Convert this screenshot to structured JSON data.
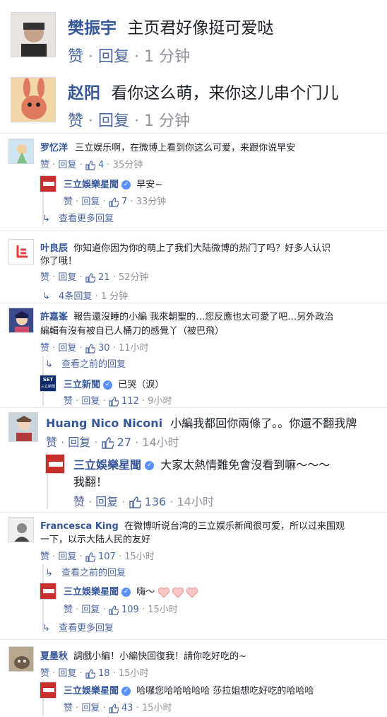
{
  "comments": [
    {
      "name": "樊振宇",
      "text": "主页君好像挺可爱哒",
      "like": "赞",
      "reply": "回复",
      "time": "1 分钟"
    },
    {
      "name": "赵阳",
      "text": "看你这么萌，来你这儿串个门儿",
      "like": "赞",
      "reply": "回复",
      "time": "1 分钟"
    },
    {
      "name": "罗忆洋",
      "text": "三立娱乐啊，在微博上看到你这么可爱，来跟你说早安",
      "like": "赞",
      "reply": "回复",
      "likes": "4",
      "time": "35分钟",
      "replies": [
        {
          "name": "三立娛樂星聞",
          "text": "早安~",
          "like": "赞",
          "reply": "回复",
          "likes": "7",
          "time": "33分钟"
        }
      ],
      "more": "查看更多回复"
    },
    {
      "name": "叶良辰",
      "text1": "你知道你因为你的萌上了我们大陆微博的热门了吗？好多人认识",
      "text2": "你了哦！",
      "like": "赞",
      "reply": "回复",
      "likes": "21",
      "time": "52分钟",
      "more": "4条回复",
      "more_time": "1 分钟"
    },
    {
      "name": "許嘉峯",
      "text1": "報告還沒睡的小編 我來朝聖的…您反應也太可愛了吧…另外政治",
      "text2": "編輯有沒有被自已人桶刀的感覺丫（被巴飛）",
      "like": "赞",
      "reply": "回复",
      "likes": "30",
      "time": "11小时",
      "prev": "查看之前的回复",
      "replies": [
        {
          "name": "三立新聞",
          "text": "已哭（淚）",
          "like": "赞",
          "reply": "回复",
          "likes": "112",
          "time": "9小时"
        }
      ]
    },
    {
      "name": "Huang Nico Niconi",
      "text": "小編我都回你兩條了。。你還不翻我牌",
      "like": "赞",
      "reply": "回复",
      "likes": "27",
      "time": "14小时",
      "replies": [
        {
          "name": "三立娛樂星聞",
          "text1": "大家太熱情難免會沒看到嘛～～～",
          "text2": "我翻！",
          "like": "赞",
          "reply": "回复",
          "likes": "136",
          "time": "14小时"
        }
      ]
    },
    {
      "name": "Francesca King",
      "text1": "在微博听说台湾的三立娱乐新闻很可爱，所以过来围观",
      "text2": "一下，以示大陆人民的友好",
      "like": "赞",
      "reply": "回复",
      "likes": "107",
      "time": "15小时",
      "prev": "查看之前的回复",
      "replies": [
        {
          "name": "三立娛樂星聞",
          "text": "嗨～",
          "like": "赞",
          "reply": "回复",
          "likes": "109",
          "time": "15小时"
        }
      ],
      "more": "查看更多回复"
    },
    {
      "name": "夏墨秋",
      "text": "調戲小編！小編快回復我！請你吃好吃的~",
      "like": "赞",
      "reply": "回复",
      "likes": "18",
      "time": "15小时",
      "replies": [
        {
          "name": "三立娛樂星聞",
          "text": "哈囉您哈哈哈哈哈 莎拉姐想吃好吃的哈哈哈",
          "like": "赞",
          "reply": "回复",
          "likes": "43",
          "time": "15小时"
        }
      ]
    }
  ],
  "avatar_labels": {
    "set_news": "SET",
    "set_sub": "三立新聞"
  },
  "colors": {
    "name": "#365899",
    "link": "#4b67a1",
    "meta": "#90949c",
    "verified": "#5890ff",
    "heart": "#f2a0a0"
  }
}
